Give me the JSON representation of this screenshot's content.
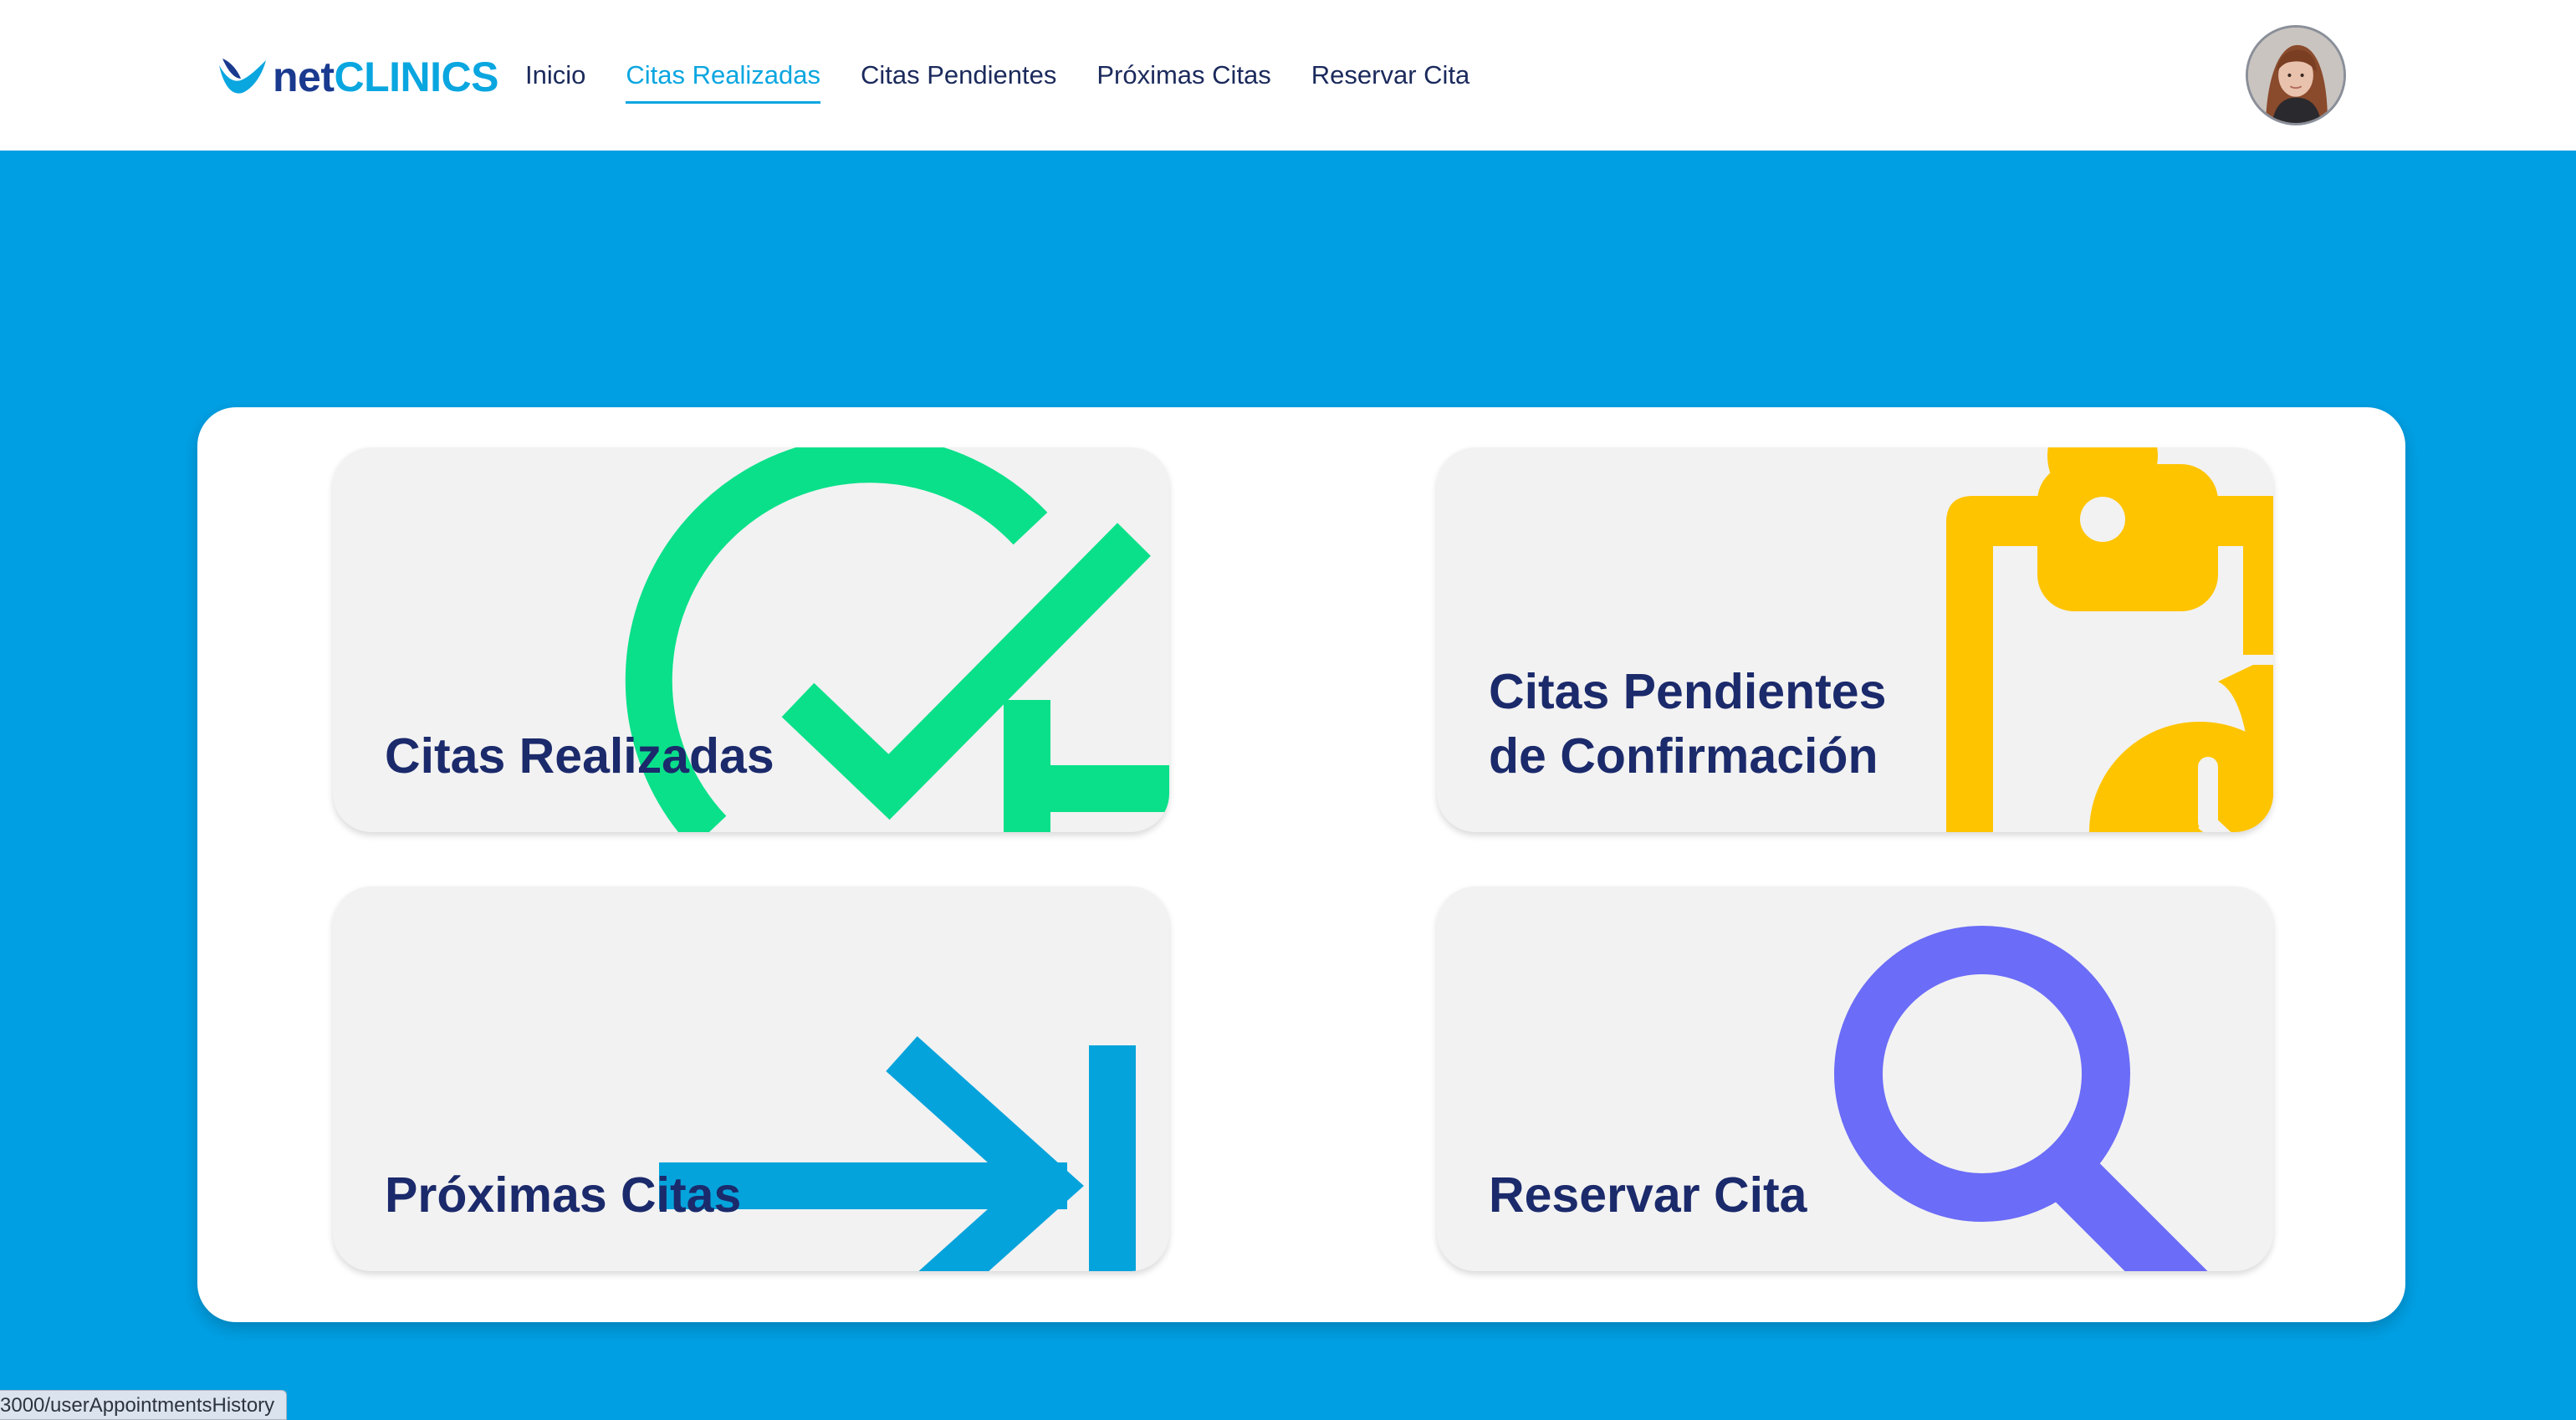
{
  "brand": {
    "name_prefix": "net",
    "name_suffix": "CLINICS",
    "primary_color": "#1a3a8f",
    "accent_color": "#0aa6e0",
    "logo_icon": "netclinics-logo-icon"
  },
  "nav": {
    "items": [
      {
        "label": "Inicio",
        "active": false
      },
      {
        "label": "Citas Realizadas",
        "active": true
      },
      {
        "label": "Citas Pendientes",
        "active": false
      },
      {
        "label": "Próximas Citas",
        "active": false
      },
      {
        "label": "Reservar Cita",
        "active": false
      }
    ]
  },
  "user": {
    "avatar_icon": "user-avatar"
  },
  "page": {
    "background_color": "#009fe3"
  },
  "cards": [
    {
      "label": "Citas Realizadas",
      "icon": "check-circle-plus-icon",
      "icon_color": "#0ae08a"
    },
    {
      "label": "Citas Pendientes de Confirmación",
      "icon": "clipboard-clock-icon",
      "icon_color": "#ffc400"
    },
    {
      "label": "Próximas Citas",
      "icon": "arrow-to-right-icon",
      "icon_color": "#05a3dc"
    },
    {
      "label": "Reservar Cita",
      "icon": "magnifier-icon",
      "icon_color": "#6b6cf7"
    }
  ],
  "status_bar": {
    "url": "3000/userAppointmentsHistory"
  }
}
